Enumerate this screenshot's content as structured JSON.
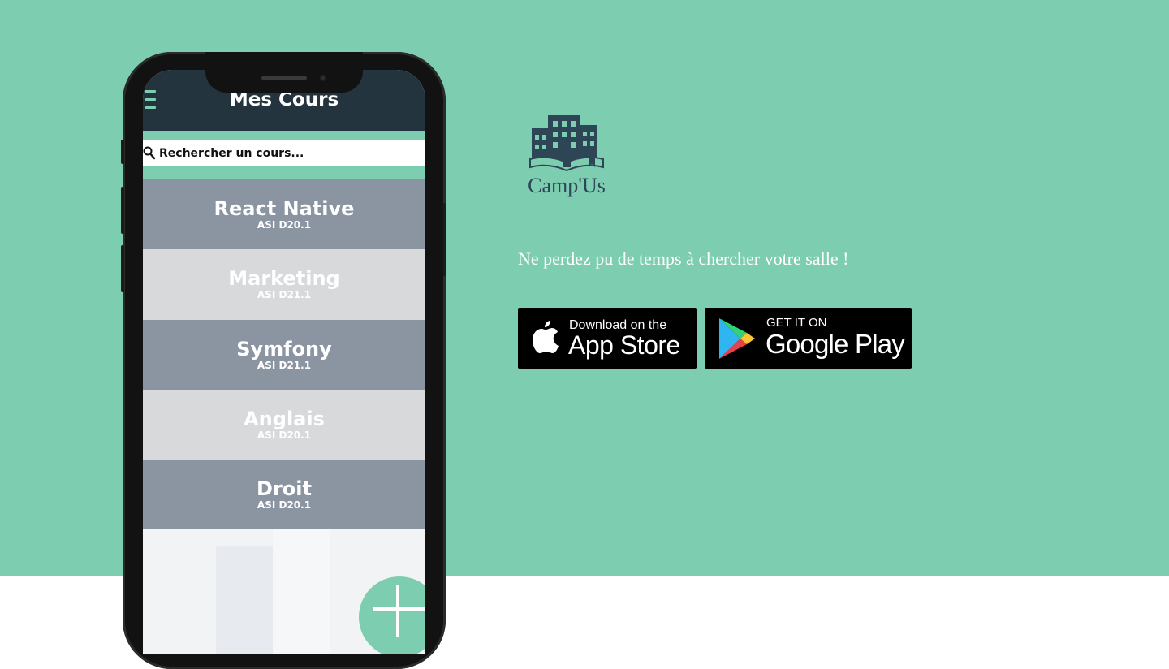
{
  "app": {
    "header_title": "Mes Cours",
    "search": {
      "placeholder": "Rechercher un cours..."
    },
    "courses": [
      {
        "name": "React Native",
        "code": "ASI D20.1"
      },
      {
        "name": "Marketing",
        "code": "ASI D21.1"
      },
      {
        "name": "Symfony",
        "code": "ASI D21.1"
      },
      {
        "name": "Anglais",
        "code": "ASI D20.1"
      },
      {
        "name": "Droit",
        "code": "ASI D20.1"
      }
    ]
  },
  "brand": {
    "name": "Camp'Us"
  },
  "tagline": "Ne perdez pu de temps à chercher votre salle !",
  "stores": {
    "appstore": {
      "small": "Download on the",
      "big": "App Store"
    },
    "googleplay": {
      "small": "GET IT ON",
      "big": "Google Play"
    }
  },
  "colors": {
    "hero_background": "#7dcdb1",
    "app_header": "#24343f",
    "course_dark": "#8a95a1",
    "course_light": "#d7d9db",
    "logo": "#2e4556"
  },
  "icons": [
    "menu-icon",
    "search-icon",
    "plus-icon",
    "apple-icon",
    "google-play-icon",
    "building-logo-icon"
  ]
}
